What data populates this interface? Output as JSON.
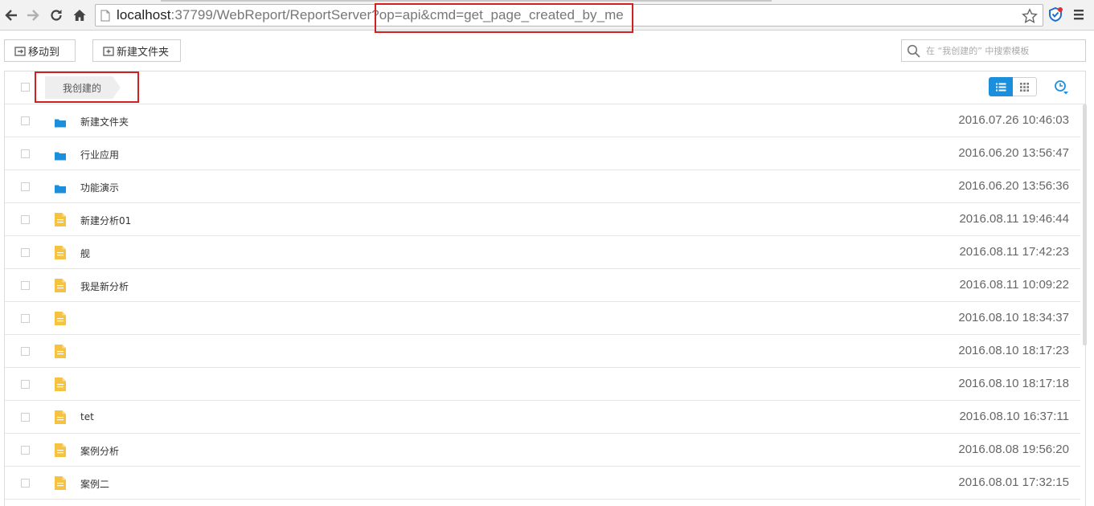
{
  "browser": {
    "url_host": "localhost",
    "url_rest": ":37799/WebReport/ReportServer?op=api&cmd=get_page_created_by_me"
  },
  "toolbar": {
    "move_to_label": "移动到",
    "new_folder_label": "新建文件夹",
    "search_placeholder": "在 “我创建的” 中搜索模板"
  },
  "breadcrumb": {
    "current": "我创建的"
  },
  "colors": {
    "accent": "#1c8fdc",
    "folder": "#1c8fdc",
    "file": "#f5c242",
    "highlight": "#d31f1f"
  },
  "items": [
    {
      "type": "folder",
      "name": "新建文件夹",
      "time": "2016.07.26 10:46:03"
    },
    {
      "type": "folder",
      "name": "行业应用",
      "time": "2016.06.20 13:56:47"
    },
    {
      "type": "folder",
      "name": "功能演示",
      "time": "2016.06.20 13:56:36"
    },
    {
      "type": "file",
      "name": "新建分析01",
      "time": "2016.08.11 19:46:44"
    },
    {
      "type": "file",
      "name": "舰",
      "time": "2016.08.11 17:42:23"
    },
    {
      "type": "file",
      "name": "我是新分析",
      "time": "2016.08.11 10:09:22"
    },
    {
      "type": "file",
      "name": "",
      "time": "2016.08.10 18:34:37"
    },
    {
      "type": "file",
      "name": "",
      "time": "2016.08.10 18:17:23"
    },
    {
      "type": "file",
      "name": "",
      "time": "2016.08.10 18:17:18"
    },
    {
      "type": "file",
      "name": "tet",
      "time": "2016.08.10 16:37:11"
    },
    {
      "type": "file",
      "name": "案例分析",
      "time": "2016.08.08 19:56:20"
    },
    {
      "type": "file",
      "name": "案例二",
      "time": "2016.08.01 17:32:15"
    }
  ]
}
